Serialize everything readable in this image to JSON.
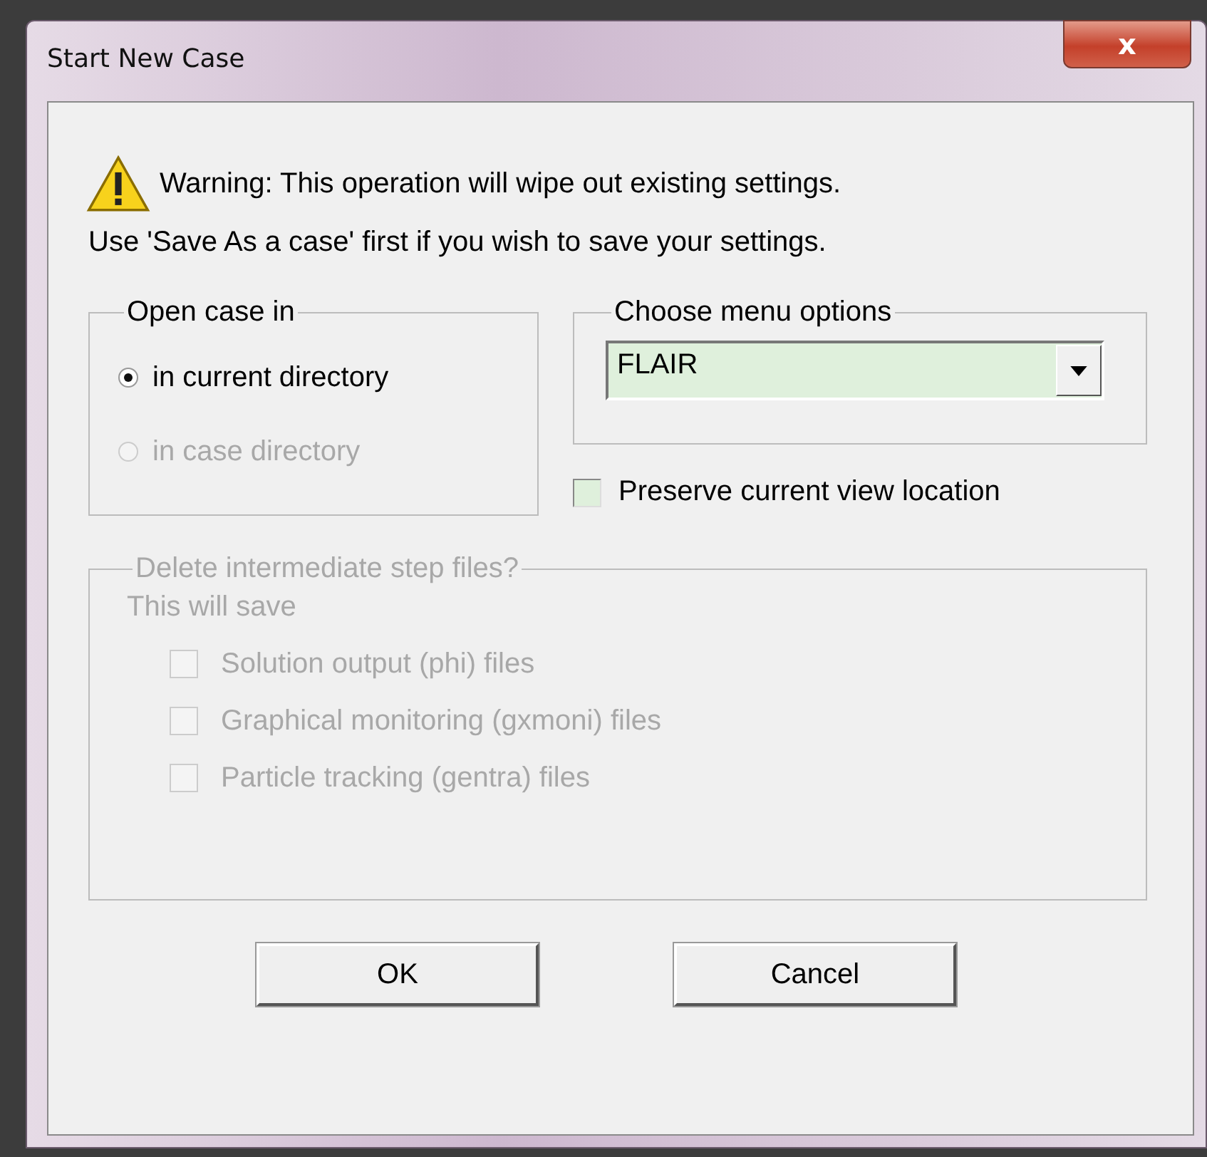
{
  "window": {
    "title": "Start New Case",
    "close_glyph": "x"
  },
  "warning": {
    "line_1": "Warning: This operation will wipe out existing settings.",
    "line_2": "Use 'Save As a case' first if you wish to save your settings."
  },
  "open_case": {
    "label": "Open case in",
    "options": [
      {
        "label": "in current directory",
        "selected": true,
        "disabled": false
      },
      {
        "label": "in case directory",
        "selected": false,
        "disabled": true
      }
    ]
  },
  "menu_options": {
    "label": "Choose menu options",
    "value": "FLAIR"
  },
  "preserve_view": {
    "label": "Preserve current view location",
    "checked": false
  },
  "delete_files": {
    "label": "Delete intermediate step files?",
    "disabled": true,
    "note": "This will save",
    "items": [
      {
        "label": "Solution output (phi) files",
        "checked": false,
        "disabled": true
      },
      {
        "label": "Graphical monitoring (gxmoni) files",
        "checked": false,
        "disabled": true
      },
      {
        "label": "Particle tracking (gentra) files",
        "checked": false,
        "disabled": true
      }
    ]
  },
  "buttons": [
    "OK",
    "Cancel"
  ]
}
